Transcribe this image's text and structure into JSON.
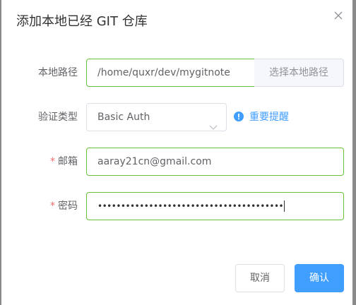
{
  "dialog": {
    "title": "添加本地已经 GIT 仓库",
    "close_icon": "close-icon"
  },
  "form": {
    "local_path": {
      "label": "本地路径",
      "value": "/home/quxr/dev/mygitnote",
      "button_label": "选择本地路径"
    },
    "auth_type": {
      "label": "验证类型",
      "selected": "Basic Auth",
      "hint_icon": "info-circle-icon",
      "hint_label": "重要提醒"
    },
    "email": {
      "required_mark": "*",
      "label": "邮箱",
      "value": "aaray21cn@gmail.com"
    },
    "password": {
      "required_mark": "*",
      "label": "密码",
      "value": "••••••••••••••••••••••••••••••••••••••••"
    }
  },
  "footer": {
    "cancel_label": "取消",
    "confirm_label": "确认"
  },
  "colors": {
    "valid_border": "#67c23a",
    "primary": "#409eff",
    "required": "#f56c6c"
  }
}
